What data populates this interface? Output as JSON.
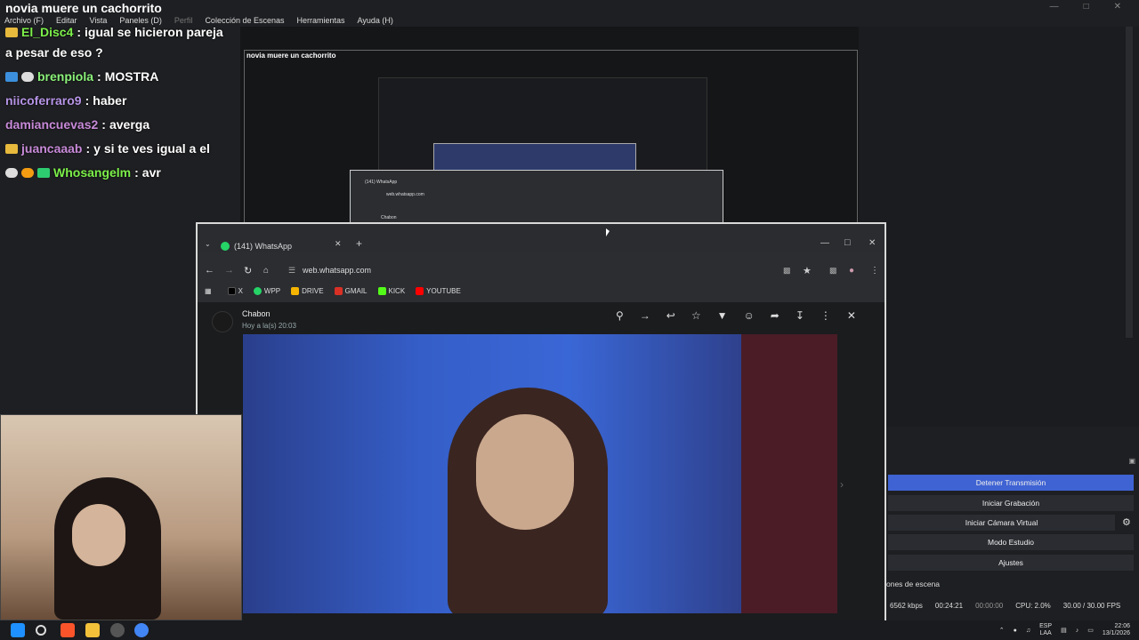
{
  "window": {
    "title": "novia muere un cachorrito"
  },
  "menu": [
    "Archivo (F)",
    "Editar",
    "Vista",
    "Paneles (D)",
    "Perfil",
    "Colección de Escenas",
    "Herramientas",
    "Ayuda (H)"
  ],
  "chat": [
    {
      "user": "El_Disc4",
      "message": "igual se hicieron pareja",
      "cont": "a pesar de eso ?",
      "color": "#7cf04a"
    },
    {
      "user": "brenpiola",
      "message": "MOSTRA",
      "color": "#8bf27a"
    },
    {
      "user": "niicoferraro9",
      "message": "haber",
      "color": "#b694e6"
    },
    {
      "user": "damiancuevas2",
      "message": "averga",
      "color": "#c78ad8"
    },
    {
      "user": "juancaaab",
      "message": "y si te ves igual a el",
      "color": "#c78ad8"
    },
    {
      "user": "Whosangelm",
      "message": "avr",
      "color": "#7cf04a"
    }
  ],
  "browser": {
    "tab_title": "(141) WhatsApp",
    "url": "web.whatsapp.com",
    "bookmarks": [
      "X",
      "WPP",
      "DRIVE",
      "GMAIL",
      "KICK",
      "YOUTUBE"
    ],
    "viewer": {
      "sender": "Chabon",
      "time": "Hoy a la(s) 20:03"
    }
  },
  "obs": {
    "buttons": [
      "Detener Transmisión",
      "Iniciar Grabación",
      "Iniciar Cámara Virtual",
      "Modo Estudio",
      "Ajustes"
    ],
    "scenes_label": "ones de escena",
    "status": {
      "bitrate": "6562 kbps",
      "live_time": "00:24:21",
      "rec_time": "00:00:00",
      "cpu": "CPU: 2.0%",
      "fps": "30.00 / 30.00 FPS"
    }
  },
  "taskbar": {
    "lang_top": "ESP",
    "lang_bottom": "LAA",
    "time": "22:06",
    "date": "13/1/2026"
  }
}
